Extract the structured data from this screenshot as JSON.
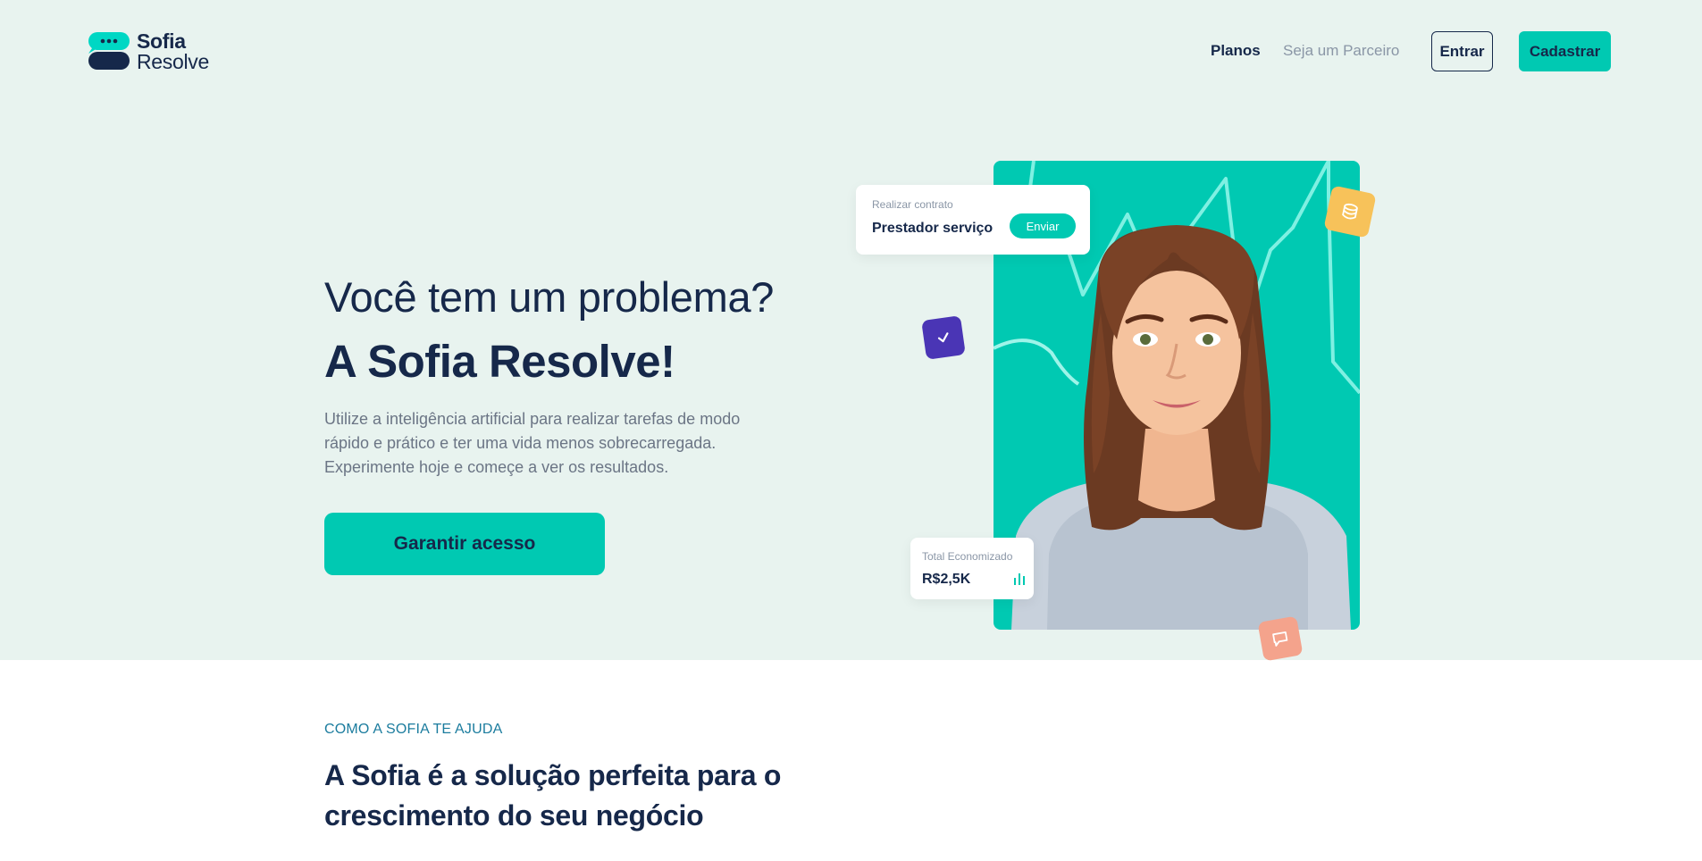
{
  "brand": {
    "name_line1": "Sofia",
    "name_line2": "Resolve"
  },
  "nav": {
    "planos": "Planos",
    "parceiro": "Seja um Parceiro",
    "entrar": "Entrar",
    "cadastrar": "Cadastrar"
  },
  "hero": {
    "question": "Você tem um problema?",
    "title": "A Sofia Resolve!",
    "description": "Utilize a inteligência artificial para realizar tarefas de modo rápido e prático e ter uma vida menos sobrecarregada. Experimente hoje e começe a ver os resultados.",
    "cta": "Garantir acesso"
  },
  "contract_card": {
    "label": "Realizar contrato",
    "value": "Prestador serviço",
    "button": "Enviar"
  },
  "total_card": {
    "label": "Total Economizado",
    "value": "R$2,5K"
  },
  "badges": [
    "database-icon",
    "check-icon",
    "chat-icon"
  ],
  "section": {
    "eyebrow": "COMO A SOFIA TE AJUDA",
    "title": "A Sofia é a solução perfeita para o crescimento do seu negócio"
  },
  "colors": {
    "primary": "#00c9b2",
    "navy": "#16284a",
    "hero_bg": "#e8f3ef",
    "badge_yellow": "#f7c25a",
    "badge_purple": "#4a35b5",
    "badge_salmon": "#f4a38c"
  }
}
